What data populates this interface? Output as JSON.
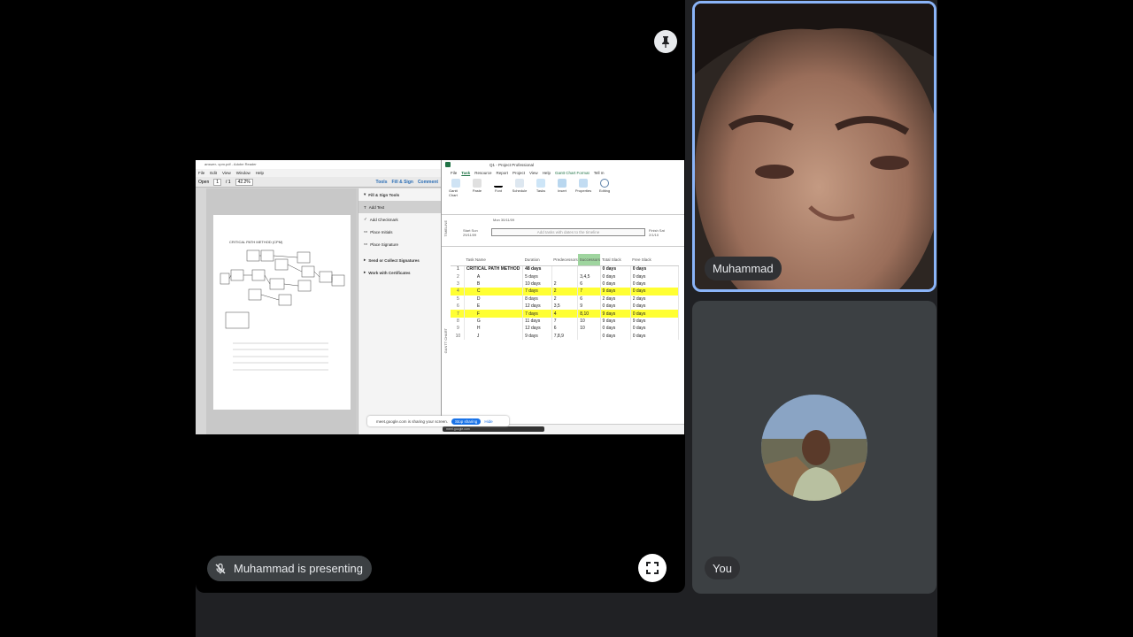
{
  "meeting": {
    "presenting_label": "Muhammad is presenting",
    "participant_name": "Muhammad",
    "you_label": "You"
  },
  "icons": {
    "pin": "pin-icon",
    "mic_off": "mic-off-icon",
    "fullscreen": "fullscreen-icon"
  },
  "adobe": {
    "title": "answer- cpm.pdf - Adobe Reader",
    "menu": [
      "File",
      "Edit",
      "View",
      "Window",
      "Help"
    ],
    "open_label": "Open",
    "page_current": "1",
    "page_total": "/ 1",
    "zoom": "42.2%",
    "tabs": [
      "Tools",
      "Fill & Sign",
      "Comment"
    ],
    "panel": {
      "header": "Fill & Sign Tools",
      "items": [
        "Add Text",
        "Add Checkmark",
        "Place Initials",
        "Place Signature"
      ],
      "send": "Send or Collect Signatures",
      "work": "Work with Certificates"
    }
  },
  "project": {
    "title": "Q1 - Project Professional",
    "tabs": [
      "File",
      "Task",
      "Resource",
      "Report",
      "Project",
      "View",
      "Help",
      "Gantt Chart Format",
      "Tell m"
    ],
    "ribbon": [
      "Gantt Chart",
      "Paste",
      "Font",
      "Schedule",
      "Tasks",
      "Insert",
      "Properties",
      "Editing"
    ],
    "ribbon_groups": [
      "View",
      "Clipboard"
    ],
    "timeline": {
      "start": "Start Sun 29/11/09",
      "date1": "Mon 30/11/09",
      "placeholder": "Add tasks with dates to the timeline",
      "finish": "Finish Sat 2/1/10"
    },
    "columns": [
      "",
      "Task Name",
      "Duration",
      "Predecessors",
      "Successors",
      "Total Slack",
      "Free Slack"
    ],
    "rows": [
      {
        "id": "1",
        "name": "CRITICAL PATH METHOD",
        "dur": "48 days",
        "pred": "",
        "succ": "",
        "total": "0 days",
        "free": "0 days"
      },
      {
        "id": "2",
        "name": "A",
        "dur": "5 days",
        "pred": "",
        "succ": "3,4,5",
        "total": "0 days",
        "free": "0 days"
      },
      {
        "id": "3",
        "name": "B",
        "dur": "10 days",
        "pred": "2",
        "succ": "6",
        "total": "0 days",
        "free": "0 days"
      },
      {
        "id": "4",
        "name": "C",
        "dur": "7 days",
        "pred": "2",
        "succ": "7",
        "total": "9 days",
        "free": "0 days"
      },
      {
        "id": "5",
        "name": "D",
        "dur": "8 days",
        "pred": "2",
        "succ": "6",
        "total": "2 days",
        "free": "2 days"
      },
      {
        "id": "6",
        "name": "E",
        "dur": "12 days",
        "pred": "3,5",
        "succ": "9",
        "total": "0 days",
        "free": "0 days"
      },
      {
        "id": "7",
        "name": "F",
        "dur": "7 days",
        "pred": "4",
        "succ": "8,10",
        "total": "9 days",
        "free": "0 days"
      },
      {
        "id": "8",
        "name": "G",
        "dur": "11 days",
        "pred": "7",
        "succ": "10",
        "total": "9 days",
        "free": "9 days"
      },
      {
        "id": "9",
        "name": "H",
        "dur": "12 days",
        "pred": "6",
        "succ": "10",
        "total": "0 days",
        "free": "0 days"
      },
      {
        "id": "10",
        "name": "J",
        "dur": "9 days",
        "pred": "7,8,9",
        "succ": "",
        "total": "0 days",
        "free": "0 days"
      }
    ],
    "side_label": "GANTT CHART",
    "timeline_label": "TIMELINE"
  },
  "share_bar": {
    "text": "meet.google.com is sharing your screen.",
    "stop": "Stop sharing",
    "hide": "Hide",
    "tab": "meet.google.com"
  },
  "colors": {
    "highlight_row": "#ffff33",
    "active_border": "#8ab4f8"
  }
}
